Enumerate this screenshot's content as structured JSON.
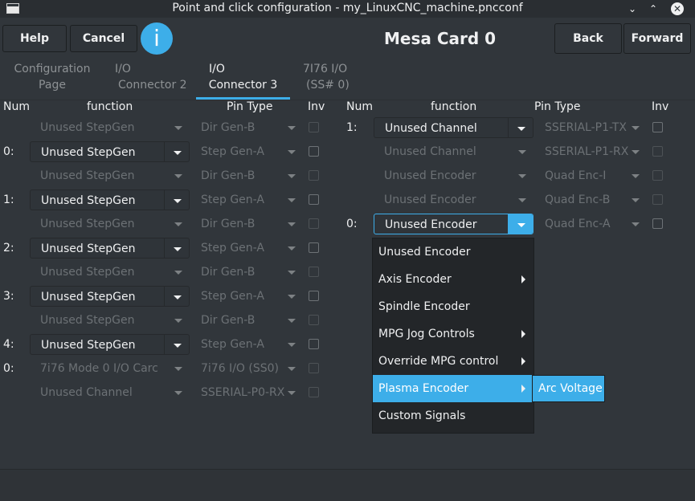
{
  "window": {
    "title": "Point and click configuration - my_LinuxCNC_machine.pncconf",
    "controls": {
      "minimize": "⌄",
      "maximize": "⌃",
      "close": "✕"
    }
  },
  "header": {
    "help_label": "Help",
    "cancel_label": "Cancel",
    "info_icon": "i",
    "title": "Mesa Card 0",
    "back_label": "Back",
    "forward_label": "Forward"
  },
  "tabs": [
    {
      "line1": "Configuration",
      "line2": "Page"
    },
    {
      "line1": "I/O",
      "line2": "Connector 2"
    },
    {
      "line1": "I/O",
      "line2": "Connector 3"
    },
    {
      "line1": "7I76 I/O",
      "line2": "(SS# 0)"
    }
  ],
  "columns": {
    "num": "Num",
    "function": "function",
    "pin_type": "Pin Type",
    "inv": "Inv"
  },
  "left_rows": [
    {
      "num": "",
      "function": "Unused StepGen",
      "pin_type": "Dir Gen-B",
      "enabled": false
    },
    {
      "num": "0:",
      "function": "Unused StepGen",
      "pin_type": "Step Gen-A",
      "enabled": true
    },
    {
      "num": "",
      "function": "Unused StepGen",
      "pin_type": "Dir Gen-B",
      "enabled": false
    },
    {
      "num": "1:",
      "function": "Unused StepGen",
      "pin_type": "Step Gen-A",
      "enabled": true
    },
    {
      "num": "",
      "function": "Unused StepGen",
      "pin_type": "Dir Gen-B",
      "enabled": false
    },
    {
      "num": "2:",
      "function": "Unused StepGen",
      "pin_type": "Step Gen-A",
      "enabled": true
    },
    {
      "num": "",
      "function": "Unused StepGen",
      "pin_type": "Dir Gen-B",
      "enabled": false
    },
    {
      "num": "3:",
      "function": "Unused StepGen",
      "pin_type": "Step Gen-A",
      "enabled": true
    },
    {
      "num": "",
      "function": "Unused StepGen",
      "pin_type": "Dir Gen-B",
      "enabled": false
    },
    {
      "num": "4:",
      "function": "Unused StepGen",
      "pin_type": "Step Gen-A",
      "enabled": true
    },
    {
      "num": "0:",
      "function": "7i76 Mode 0 I/O Carc",
      "pin_type": "7i76 I/O (SS0)",
      "enabled": false
    },
    {
      "num": "",
      "function": "Unused Channel",
      "pin_type": "SSERIAL-P0-RX",
      "enabled": false
    }
  ],
  "right_rows": [
    {
      "num": "1:",
      "function": "Unused Channel",
      "pin_type": "SSERIAL-P1-TX",
      "enabled": true
    },
    {
      "num": "",
      "function": "Unused Channel",
      "pin_type": "SSERIAL-P1-RX",
      "enabled": false
    },
    {
      "num": "",
      "function": "Unused Encoder",
      "pin_type": "Quad Enc-I",
      "enabled": false
    },
    {
      "num": "",
      "function": "Unused Encoder",
      "pin_type": "Quad Enc-B",
      "enabled": false
    },
    {
      "num": "0:",
      "function": "Unused Encoder",
      "pin_type": "Quad Enc-A",
      "enabled": true,
      "open": true
    }
  ],
  "dropdown": {
    "items": [
      {
        "label": "Unused Encoder",
        "submenu": false
      },
      {
        "label": "Axis Encoder",
        "submenu": true
      },
      {
        "label": "Spindle Encoder",
        "submenu": false
      },
      {
        "label": "MPG Jog Controls",
        "submenu": true
      },
      {
        "label": "Override MPG control",
        "submenu": true
      },
      {
        "label": "Plasma Encoder",
        "submenu": true,
        "highlighted": true
      },
      {
        "label": "Custom Signals",
        "submenu": false
      }
    ],
    "submenu_items": [
      {
        "label": "Arc Voltage",
        "highlighted": true
      }
    ]
  },
  "colors": {
    "accent": "#3daee9",
    "background": "#31363b",
    "text": "#eff0f1",
    "disabled_text": "#6c7175"
  }
}
